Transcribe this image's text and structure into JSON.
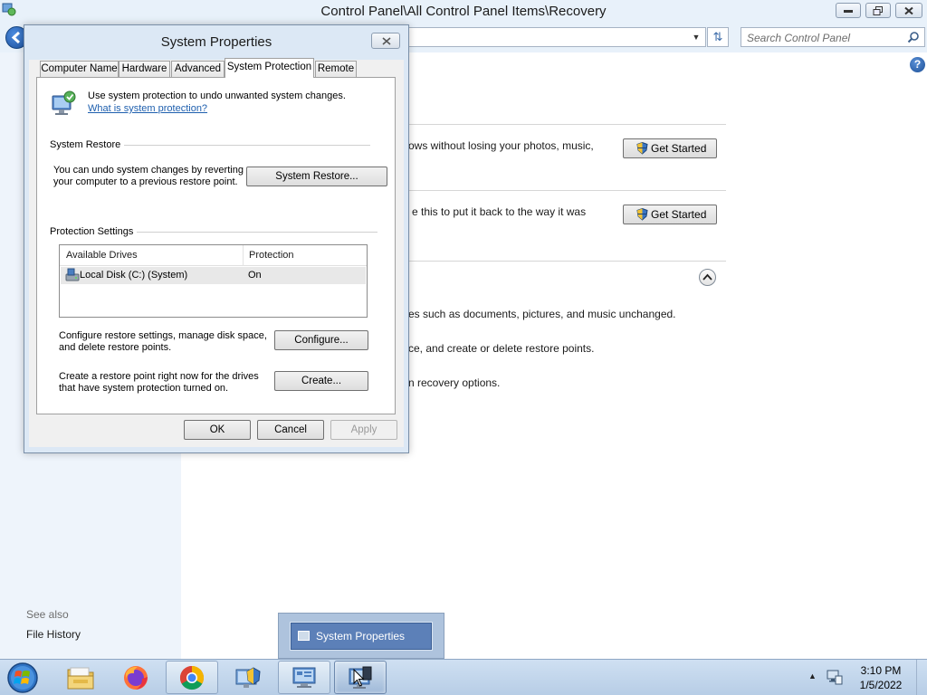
{
  "control_panel": {
    "title": "Control Panel\\All Control Panel Items\\Recovery",
    "search_placeholder": "Search Control Panel",
    "content_fragments": [
      "ows without losing your photos, music,",
      "e this to put it back to the way it was",
      "es such as documents, pictures, and music unchanged.",
      "ce, and create or delete restore points.",
      "n recovery options."
    ],
    "get_started_label": "Get Started",
    "see_also_label": "See also",
    "file_history_label": "File History",
    "help_glyph": "?"
  },
  "dialog": {
    "title": "System Properties",
    "tabs": [
      "Computer Name",
      "Hardware",
      "Advanced",
      "System Protection",
      "Remote"
    ],
    "active_tab": "System Protection",
    "intro_text": "Use system protection to undo unwanted system changes.",
    "intro_link": "What is system protection?",
    "system_restore": {
      "group_label": "System Restore",
      "description": "You can undo system changes by reverting your computer to a previous restore point.",
      "button_label": "System Restore..."
    },
    "protection_settings": {
      "group_label": "Protection Settings",
      "columns": [
        "Available Drives",
        "Protection"
      ],
      "rows": [
        {
          "drive": "Local Disk (C:) (System)",
          "protection": "On"
        }
      ],
      "configure_desc": "Configure restore settings, manage disk space, and delete restore points.",
      "configure_label": "Configure...",
      "create_desc": "Create a restore point right now for the drives that have system protection turned on.",
      "create_label": "Create..."
    },
    "ok_label": "OK",
    "cancel_label": "Cancel",
    "apply_label": "Apply"
  },
  "thumbnail": {
    "label": "System Properties"
  },
  "taskbar": {
    "items": [
      "windows-explorer",
      "firefox",
      "chrome",
      "control-panel",
      "network-and-sharing",
      "system-properties"
    ],
    "clock_time": "3:10 PM",
    "clock_date": "1/5/2022"
  },
  "colors": {
    "link": "#1e5fae",
    "window_chrome": "#dce8f5",
    "taskbar": "#b7cde6"
  }
}
